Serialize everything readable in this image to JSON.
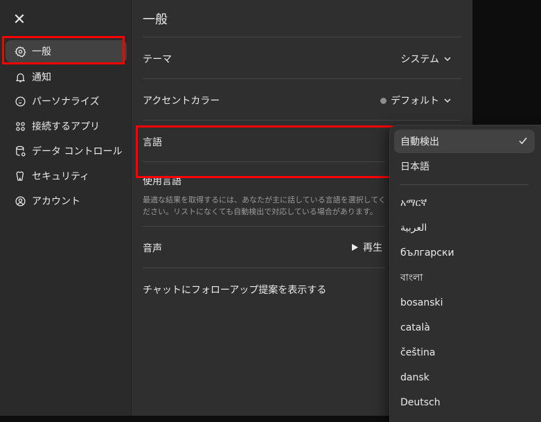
{
  "sidebar": {
    "close_glyph": "✕",
    "items": [
      {
        "label": "一般",
        "icon": "gear-icon"
      },
      {
        "label": "通知",
        "icon": "bell-icon"
      },
      {
        "label": "パーソナライズ",
        "icon": "personalize-icon"
      },
      {
        "label": "接続するアプリ",
        "icon": "apps-grid-icon"
      },
      {
        "label": "データ コントロール",
        "icon": "database-icon"
      },
      {
        "label": "セキュリティ",
        "icon": "shield-icon"
      },
      {
        "label": "アカウント",
        "icon": "user-circle-icon"
      }
    ]
  },
  "main": {
    "title": "一般",
    "theme": {
      "label": "テーマ",
      "value": "システム"
    },
    "accent": {
      "label": "アクセントカラー",
      "value": "デフォルト",
      "dot_color": "#8e8e8e"
    },
    "language": {
      "label": "言語"
    },
    "spoken": {
      "label": "使用言語",
      "description": "最適な結果を取得するには、あなたが主に話している言語を選択してください。リストになくても自動検出で対応している場合があります。"
    },
    "voice": {
      "label": "音声",
      "play_label": "再生"
    },
    "followup": {
      "label": "チャットにフォローアップ提案を表示する"
    }
  },
  "dropdown": {
    "selected": "自動検出",
    "top_options": [
      "自動検出",
      "日本語"
    ],
    "options": [
      "አማርኛ",
      "العربية",
      "български",
      "বাংলা",
      "bosanski",
      "català",
      "čeština",
      "dansk",
      "Deutsch"
    ]
  },
  "highlight_color": "#ff0000"
}
